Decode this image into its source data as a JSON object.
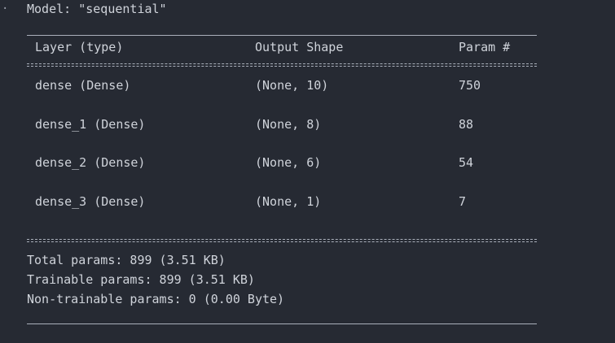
{
  "model_title": "Model: \"sequential\"",
  "table": {
    "headers": [
      "Layer (type)",
      "Output Shape",
      "Param #"
    ],
    "rows": [
      {
        "layer": "dense (Dense)",
        "shape": "(None, 10)",
        "params": "750"
      },
      {
        "layer": "dense_1 (Dense)",
        "shape": "(None, 8)",
        "params": "88"
      },
      {
        "layer": "dense_2 (Dense)",
        "shape": "(None, 6)",
        "params": "54"
      },
      {
        "layer": "dense_3 (Dense)",
        "shape": "(None, 1)",
        "params": "7"
      }
    ]
  },
  "summary": {
    "total": "Total params: 899 (3.51 KB)",
    "trainable": "Trainable params: 899 (3.51 KB)",
    "non_trainable": "Non-trainable params: 0 (0.00 Byte)"
  }
}
